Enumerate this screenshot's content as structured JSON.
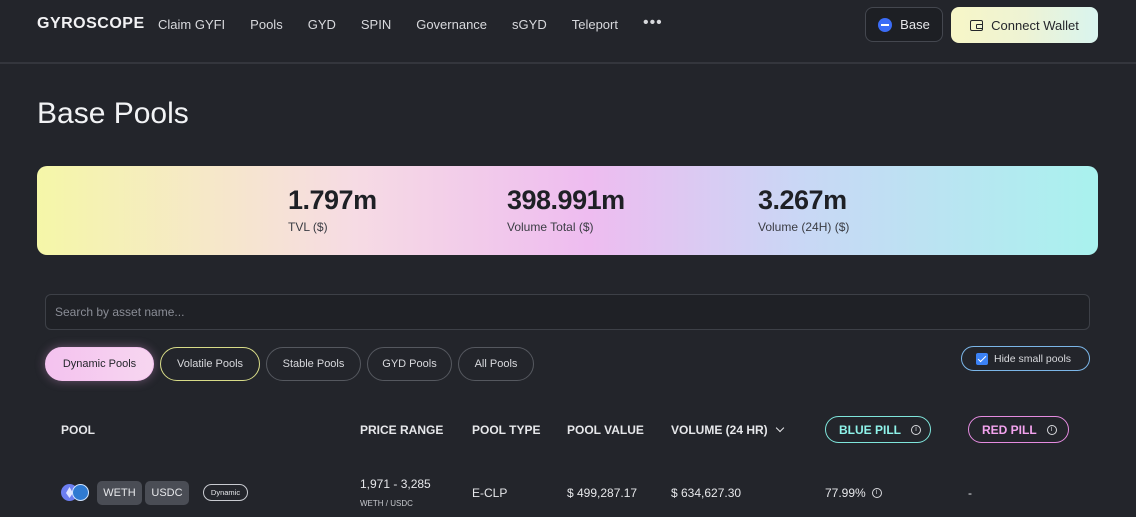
{
  "header": {
    "logo": "GYROSCOPE",
    "nav": [
      "Claim GYFI",
      "Pools",
      "GYD",
      "SPIN",
      "Governance",
      "sGYD",
      "Teleport"
    ],
    "more": "•••",
    "network": "Base",
    "connect_label": "Connect Wallet"
  },
  "page": {
    "title": "Base Pools"
  },
  "stats": [
    {
      "value": "1.797m",
      "label": "TVL ($)"
    },
    {
      "value": "398.991m",
      "label": "Volume Total ($)"
    },
    {
      "value": "3.267m",
      "label": "Volume (24H) ($)"
    }
  ],
  "search": {
    "placeholder": "Search by asset name...",
    "value": ""
  },
  "filters": {
    "items": [
      "Dynamic Pools",
      "Volatile Pools",
      "Stable Pools",
      "GYD Pools",
      "All Pools"
    ],
    "active": "Dynamic Pools",
    "hide_small_label": "Hide small pools",
    "hide_small_checked": true
  },
  "table": {
    "columns": {
      "pool": "POOL",
      "price_range": "PRICE RANGE",
      "pool_type": "POOL TYPE",
      "pool_value": "POOL VALUE",
      "volume": "VOLUME (24 HR)",
      "blue_pill": "BLUE PILL",
      "red_pill": "RED PILL"
    },
    "rows": [
      {
        "tokens": [
          "WETH",
          "USDC"
        ],
        "type_badge": "Dynamic",
        "price_range": "1,971 - 3,285",
        "price_unit": "WETH / USDC",
        "pool_type": "E-CLP",
        "pool_value": "$ 499,287.17",
        "volume": "$ 634,627.30",
        "blue_pill": "77.99%",
        "red_pill": "-"
      }
    ]
  },
  "colors": {
    "background": "#23252b",
    "blue_pill": "#8ff3ea",
    "red_pill": "#f3a3ee",
    "active_filter": "#f4c2ef"
  }
}
